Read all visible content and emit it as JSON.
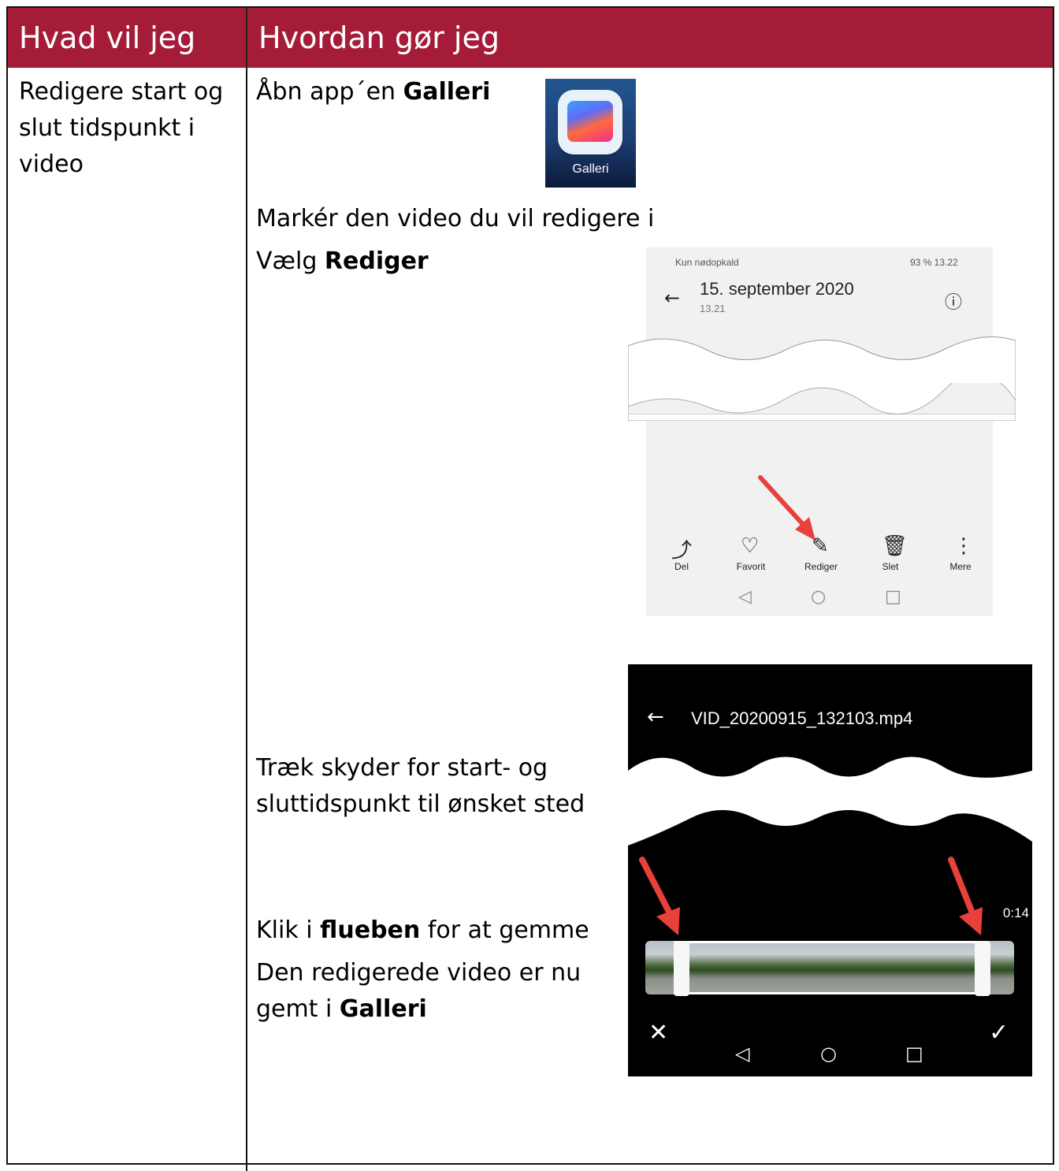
{
  "header": {
    "col1": "Hvad vil jeg",
    "col2": "Hvordan gør jeg"
  },
  "task": {
    "line1": "Redigere start og",
    "line2": "slut tidspunkt i",
    "line3": "video"
  },
  "steps": {
    "open_prefix": "Åbn app´en ",
    "open_bold": "Galleri",
    "mark": "Markér den video du vil redigere i",
    "choose_prefix": "Vælg ",
    "choose_bold": "Rediger",
    "drag_line1": "Træk skyder for start- og",
    "drag_line2": "sluttidspunkt til ønsket sted",
    "click_prefix": "Klik i ",
    "click_bold": "flueben",
    "click_suffix": " for at gemme",
    "saved_line1": "Den redigerede video er nu",
    "saved_prefix": "gemt i ",
    "saved_bold": "Galleri"
  },
  "app_icon": {
    "label": "Galleri",
    "icon": "gallery-app-icon"
  },
  "screenshot1": {
    "status_left": "Kun nødopkald",
    "status_right": "93 %  13.22",
    "date": "15. september 2020",
    "time": "13.21",
    "actions": [
      "Del",
      "Favorit",
      "Rediger",
      "Slet",
      "Mere"
    ]
  },
  "screenshot2": {
    "filename": "VID_20200915_132103.mp4",
    "end_time": "0:14"
  },
  "colors": {
    "header": "#a51c38",
    "arrow": "#e8403a"
  }
}
